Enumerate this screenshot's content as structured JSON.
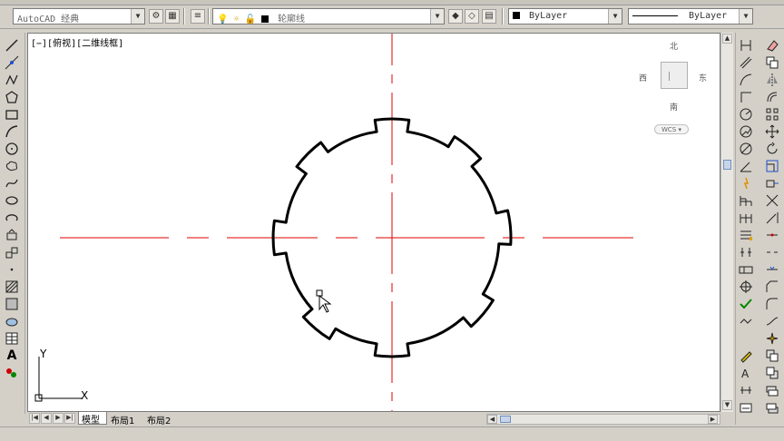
{
  "toolbar": {
    "workspace": "AutoCAD 经典",
    "layer": "轮廓线",
    "color": "ByLayer",
    "linetype": "ByLayer"
  },
  "viewport": {
    "label": "[−][俯视][二维线框]"
  },
  "viewcube": {
    "north": "北",
    "south": "南",
    "east": "东",
    "west": "西",
    "wcs": "WCS"
  },
  "ucs": {
    "x_label": "X",
    "y_label": "Y"
  },
  "tabs": [
    {
      "label": "模型"
    },
    {
      "label": "布局1"
    },
    {
      "label": "布局2"
    }
  ],
  "colors": {
    "centerline": "#e00000",
    "outline": "#000000",
    "background": "#ffffff"
  }
}
